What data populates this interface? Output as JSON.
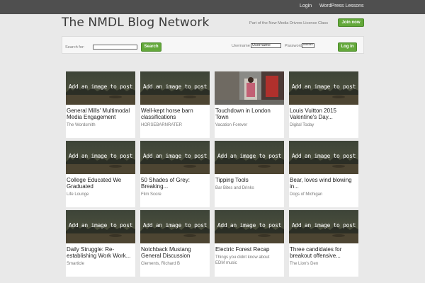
{
  "topbar": {
    "login": "Login",
    "lessons": "WordPress Lessons"
  },
  "header": {
    "title": "The NMDL Blog Network",
    "part_of": "Part of the New Media Drivers License Class",
    "join": "Join now"
  },
  "searchbar": {
    "search_label": "Search for:",
    "search_value": "",
    "search_button": "Search",
    "username_label": "Username",
    "username_value": "Username",
    "password_label": "Password",
    "password_value": "•••••••",
    "login_button": "Log in"
  },
  "placeholder_text": "Add an image to post",
  "posts": [
    {
      "title": "General Mills' Multimodal Media Engagement",
      "source": "The Wordsmith",
      "thumb": "placeholder"
    },
    {
      "title": "Well-kept horse barn classifications",
      "source": "HORSEBARNRATER",
      "thumb": "placeholder"
    },
    {
      "title": "Touchdown in London Town",
      "source": "Vacation Forever",
      "thumb": "photo"
    },
    {
      "title": "Louis Vuitton 2015 Valentine's Day...",
      "source": "Digital Today",
      "thumb": "placeholder"
    },
    {
      "title": "College Educated We Graduated",
      "source": "Life Lounge",
      "thumb": "placeholder"
    },
    {
      "title": "50 Shades of Grey: Breaking...",
      "source": "Film Score",
      "thumb": "placeholder"
    },
    {
      "title": "Tipping Tools",
      "source": "Bar Bites and Drinks",
      "thumb": "placeholder"
    },
    {
      "title": "Bear, loves wind blowing in...",
      "source": "Dogs of Michigan",
      "thumb": "placeholder"
    },
    {
      "title": "Daily Struggle: Re-establishing Work Work...",
      "source": "Smarticle",
      "thumb": "placeholder"
    },
    {
      "title": "Notchback Mustang General Discussion",
      "source": "Clements, Richard B",
      "thumb": "placeholder"
    },
    {
      "title": "Electric Forest Recap",
      "source": "Things you didnt know about EDM music",
      "thumb": "placeholder"
    },
    {
      "title": "Three candidates for breakout offensive...",
      "source": "The Lion's Den",
      "thumb": "placeholder"
    }
  ],
  "colors": {
    "topbar": "#4f4f4f",
    "accent_green": "#63a83a",
    "page_bg": "#e9e9e9"
  }
}
